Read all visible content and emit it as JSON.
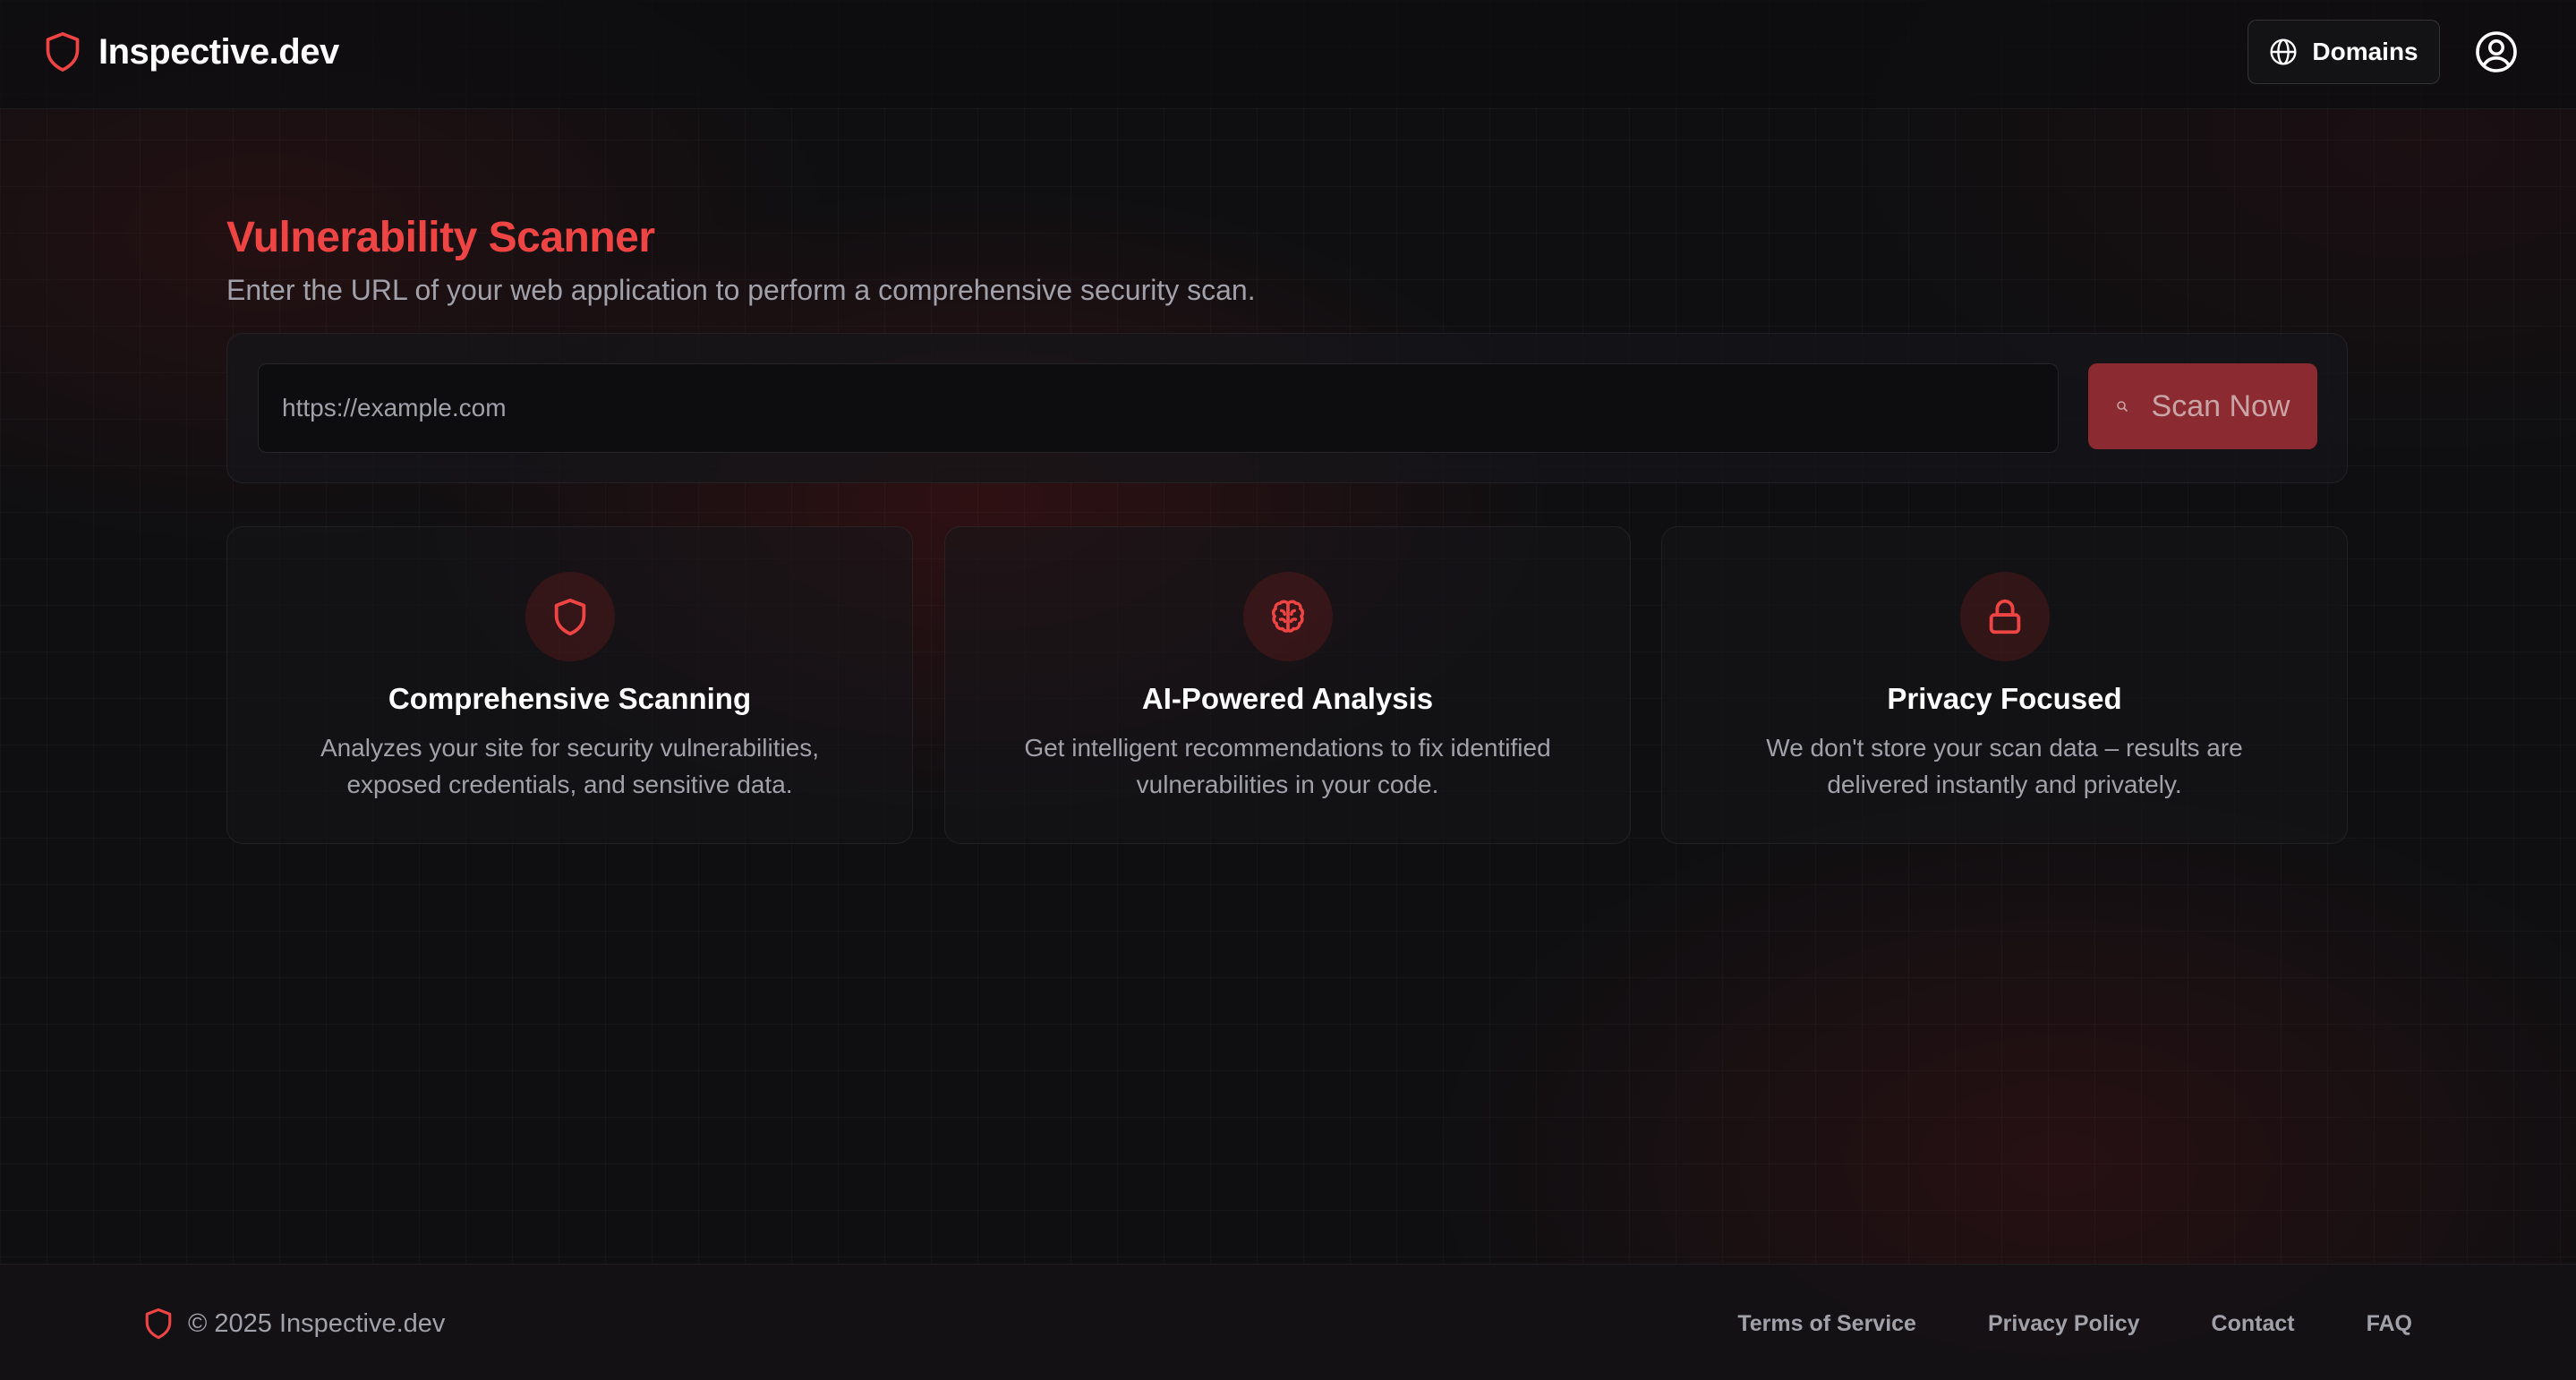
{
  "header": {
    "brand_name": "Inspective.dev",
    "brand_icon": "shield-icon",
    "domains_label": "Domains",
    "domains_icon": "globe-icon",
    "user_icon": "user-circle-icon"
  },
  "main": {
    "title": "Vulnerability Scanner",
    "subtitle": "Enter the URL of your web application to perform a comprehensive security scan.",
    "url_input": {
      "value": "",
      "placeholder": "https://example.com"
    },
    "scan_button_label": "Scan Now",
    "features": [
      {
        "icon": "shield-icon",
        "title": "Comprehensive Scanning",
        "description": "Analyzes your site for security vulnerabilities, exposed credentials, and sensitive data."
      },
      {
        "icon": "brain-icon",
        "title": "AI-Powered Analysis",
        "description": "Get intelligent recommendations to fix identified vulnerabilities in your code."
      },
      {
        "icon": "lock-icon",
        "title": "Privacy Focused",
        "description": "We don't store your scan data – results are delivered instantly and privately."
      }
    ]
  },
  "footer": {
    "copyright": "© 2025 Inspective.dev",
    "links": [
      "Terms of Service",
      "Privacy Policy",
      "Contact",
      "FAQ"
    ]
  },
  "colors": {
    "accent": "#ef4444",
    "background": "#0f0f11",
    "muted_text": "#a1a1aa",
    "scan_button": "#8b2a31"
  }
}
